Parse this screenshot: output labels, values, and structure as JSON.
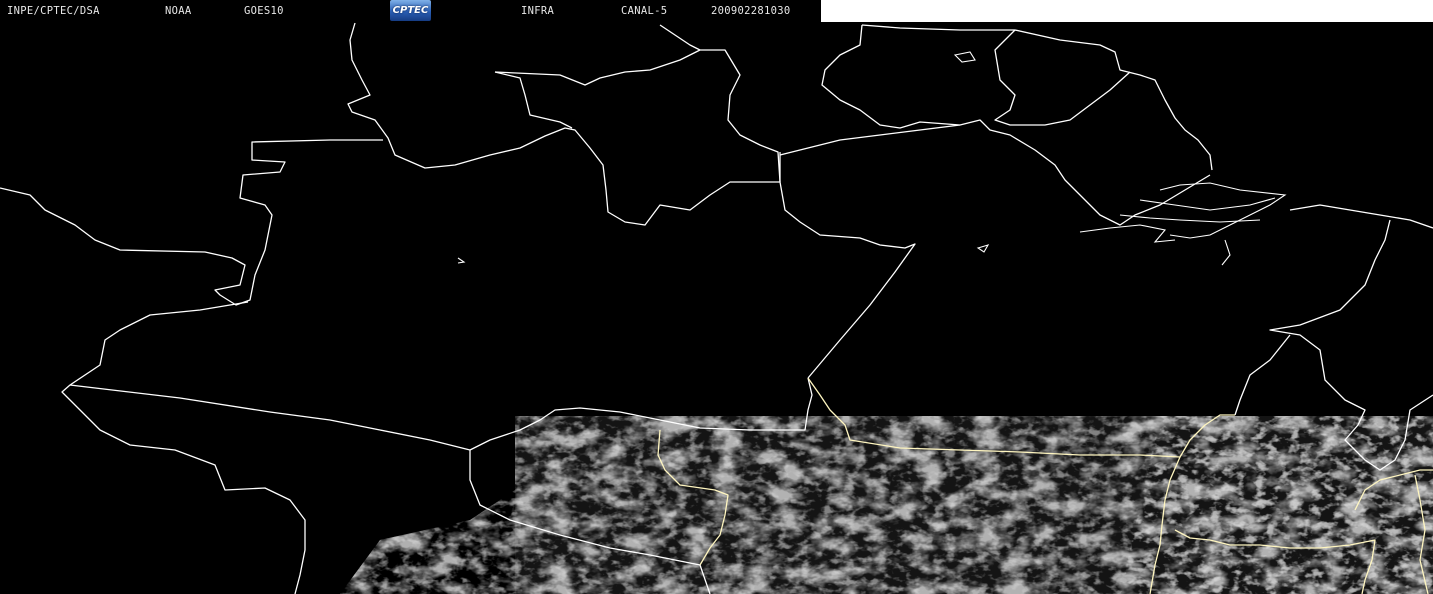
{
  "header": {
    "agency": "INPE/CPTEC/DSA",
    "source": "NOAA",
    "satellite": "GOES10",
    "logo_text": "CPTEC",
    "band": "INFRA",
    "channel": "CANAL-5",
    "timestamp": "200902281030"
  },
  "colors": {
    "background": "#000000",
    "borders": "#ffffff",
    "state_borders": "#fffbd0",
    "cloud": "#8a8a8a",
    "header_text": "#e8e8e8",
    "logo": "#2a5fb5"
  },
  "map": {
    "type": "satellite-infrared-image",
    "region": "Northern South America",
    "grid": false
  }
}
